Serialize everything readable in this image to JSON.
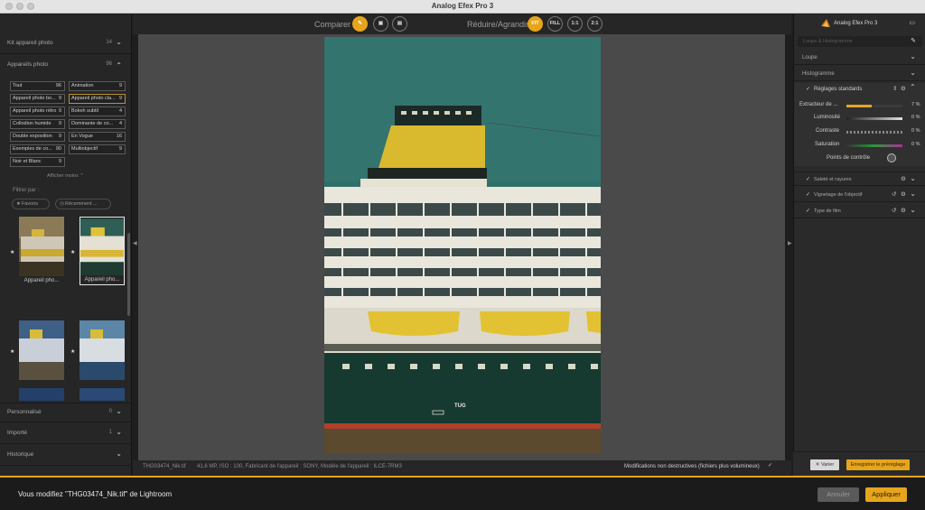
{
  "window": {
    "title": "Analog Efex Pro 3"
  },
  "left": {
    "kit": {
      "label": "Kit appareil photo",
      "count": "14"
    },
    "cameras": {
      "label": "Appareils photo",
      "count": "96"
    },
    "categories": [
      {
        "label": "Tout",
        "count": "96"
      },
      {
        "label": "Animation",
        "count": "9"
      },
      {
        "label": "Appareil photo bo...",
        "count": "9"
      },
      {
        "label": "Appareil photo cla...",
        "count": "9"
      },
      {
        "label": "Appareil photo rétro",
        "count": "9"
      },
      {
        "label": "Bokeh subtil",
        "count": "4"
      },
      {
        "label": "Collodion humide",
        "count": "9"
      },
      {
        "label": "Dominante de co...",
        "count": "4"
      },
      {
        "label": "Double exposition",
        "count": "9"
      },
      {
        "label": "En Vogue",
        "count": "16"
      },
      {
        "label": "Exemples de co...",
        "count": "90"
      },
      {
        "label": "Multiobjectif",
        "count": "9"
      },
      {
        "label": "Noir et Blanc",
        "count": "9"
      }
    ],
    "show_more": "Afficher moins",
    "filter_label": "Filtrer par :",
    "filter_pills": [
      "Favoris",
      "Récemment ..."
    ],
    "thumbs": [
      {
        "caption": "Appareil pho..."
      },
      {
        "caption": "Appareil pho..."
      },
      {
        "caption": ""
      },
      {
        "caption": ""
      }
    ],
    "personal": {
      "label": "Personnalisé",
      "count": "0"
    },
    "imported": {
      "label": "Importé",
      "count": "1"
    },
    "history": {
      "label": "Historique"
    }
  },
  "toolbar": {
    "compare_label": "Comparer",
    "zoom_label": "Réduire/Agrandir",
    "zoom_options": [
      "FIT",
      "FILL",
      "1:1",
      "2:1"
    ]
  },
  "photo": {
    "tug_label": "TUG"
  },
  "status": {
    "filename": "THG03474_Nik.tif",
    "meta": "41,6 MP, ISO : 100, Fabricant de l'appareil : SONY, Modèle de l'appareil : ILCE-7RM3",
    "nondestructive": "Modifications non destructives (fichiers plus volumineux)"
  },
  "right": {
    "app_name": "Analog Efex Pro 3",
    "search_placeholder": "Loupe & Histogramme",
    "loupe": "Loupe",
    "histogram": "Histogramme",
    "basic": "Réglages standards",
    "sliders": [
      {
        "label": "Extracteur de ...",
        "value": "7 %",
        "fill": 0.45
      },
      {
        "label": "Luminosité",
        "value": "0 %",
        "fill": 0.5
      },
      {
        "label": "Contraste",
        "value": "0 %",
        "fill": 0.5
      },
      {
        "label": "Saturation",
        "value": "0 %",
        "fill": 0.5
      }
    ],
    "control_points": "Points de contrôle",
    "sections": [
      "Saleté et rayures",
      "Vignetage de l'objectif",
      "Type de film"
    ],
    "vary": "Varier",
    "save_preset": "Enregistrer le prérèglage"
  },
  "bottom": {
    "message": "Vous modifiez \"THG03474_Nik.tif\" de Lightroom",
    "cancel": "Annuler",
    "apply": "Appliquer"
  },
  "colors": {
    "accent": "#e6a51d"
  }
}
